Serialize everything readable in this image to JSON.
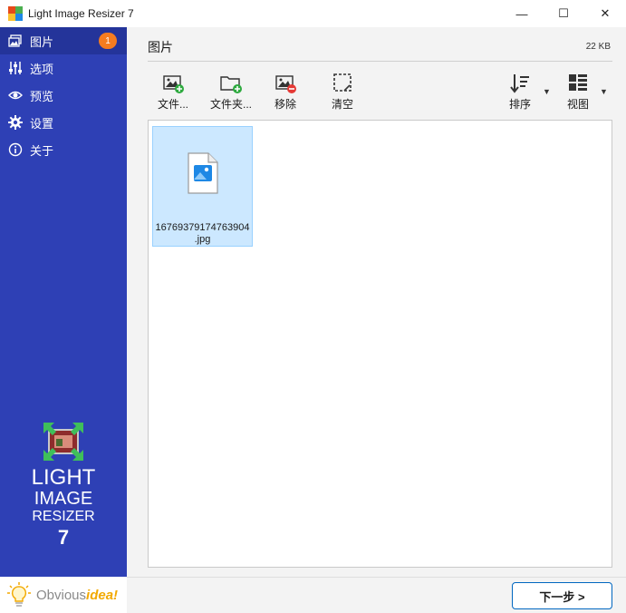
{
  "window": {
    "title": "Light Image Resizer 7",
    "controls": {
      "minimize": "—",
      "maximize": "☐",
      "close": "✕"
    }
  },
  "sidebar": {
    "accent_color": "#2e40b5",
    "items": [
      {
        "label": "图片",
        "icon": "images-icon",
        "active": true,
        "badge": "1"
      },
      {
        "label": "选项",
        "icon": "sliders-icon",
        "active": false
      },
      {
        "label": "预览",
        "icon": "eye-icon",
        "active": false
      },
      {
        "label": "设置",
        "icon": "gear-icon",
        "active": false
      },
      {
        "label": "关于",
        "icon": "info-icon",
        "active": false
      }
    ],
    "logo": {
      "line1": "LIGHT",
      "line2": "IMAGE",
      "line3": "RESIZER",
      "line4": "7"
    },
    "vendor": {
      "part1": "Obvious",
      "part2": "idea!"
    }
  },
  "main": {
    "title": "图片",
    "total_size": "22 KB",
    "toolbar": {
      "add_files": "文件...",
      "add_folder": "文件夹...",
      "remove": "移除",
      "clear": "清空",
      "sort": "排序",
      "view": "视图"
    },
    "files": [
      {
        "name_line1": "16769379174763904",
        "name_line2": ".jpg",
        "selected": true
      }
    ]
  },
  "footer": {
    "next_label": "下一步 >"
  }
}
